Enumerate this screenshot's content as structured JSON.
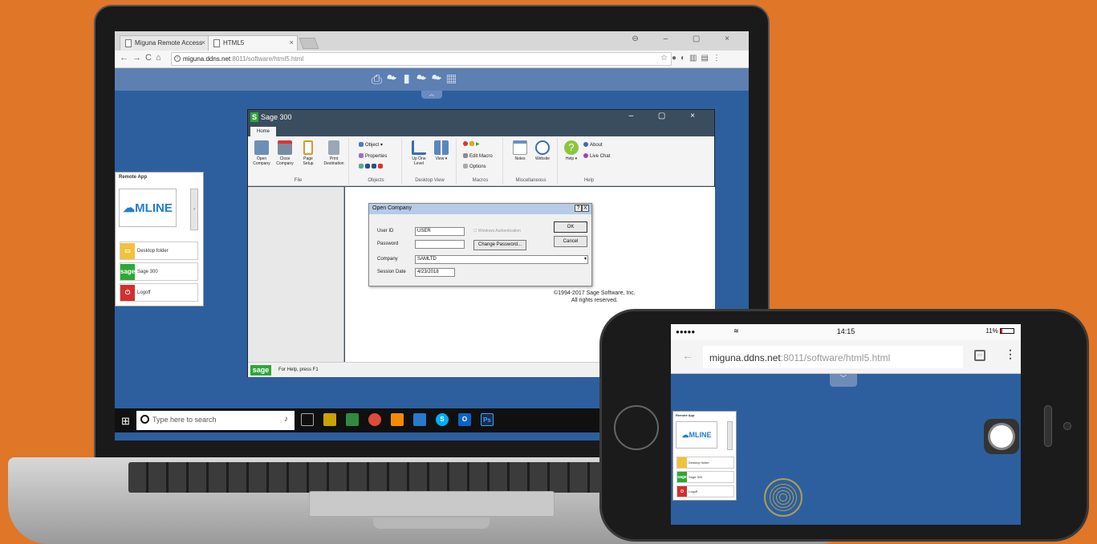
{
  "browser": {
    "tabs": [
      {
        "label": "Miguna Remote Access"
      },
      {
        "label": "HTML5"
      }
    ],
    "url_host": "miguna.ddns.net",
    "url_path": ":8011/software/html5.html"
  },
  "remote_app_panel": {
    "title": "Remote App",
    "logo_text": "MLINE",
    "items": [
      {
        "label": "Desktop folder",
        "icon": "folder-icon",
        "color": "#f3c13a"
      },
      {
        "label": "Sage 300",
        "icon": "sage-icon",
        "color": "#2da836",
        "icon_text": "sage"
      },
      {
        "label": "Logoff",
        "icon": "power-icon",
        "color": "#d0302f"
      }
    ]
  },
  "sage": {
    "title": "Sage 300",
    "ribbon_tab": "Home",
    "file_group": {
      "label": "File",
      "buttons": [
        "Open Company",
        "Close Company",
        "Page Setup",
        "Print Destination"
      ]
    },
    "objects_group": {
      "label": "Objects",
      "object": "Object",
      "properties": "Properties"
    },
    "desktop_view_group": {
      "label": "Desktop View",
      "up_one_level": "Up One Level",
      "view": "View"
    },
    "macros_group": {
      "label": "Macros",
      "edit_macro": "Edit Macro",
      "options": "Options"
    },
    "misc_group": {
      "label": "Miscellaneous",
      "notes": "Notes",
      "website": "Website"
    },
    "help_group": {
      "label": "Help",
      "help": "Help",
      "about": "About",
      "live_chat": "Live Chat"
    },
    "copyright_line1": "©1994-2017 Sage Software, Inc.",
    "copyright_line2": "All rights reserved.",
    "status_text": "For Help, press F1",
    "status_logo": "sage"
  },
  "dialog": {
    "title": "Open Company",
    "help_btn": "?",
    "close_btn": "X",
    "user_id_label": "User ID",
    "user_id_value": "USER",
    "password_label": "Password",
    "password_value": "",
    "windows_auth_label": "Windows Authentication",
    "change_password": "Change Password...",
    "company_label": "Company",
    "company_value": "SAMLTD",
    "session_date_label": "Session Date",
    "session_date_value": "4/23/2018",
    "ok": "OK",
    "cancel": "Cancel"
  },
  "taskbar": {
    "search_placeholder": "Type here to search",
    "apps": [
      {
        "icon": "task-view-icon",
        "color": "#333333",
        "text": ""
      },
      {
        "icon": "winamp-icon",
        "color": "#c9a400",
        "text": ""
      },
      {
        "icon": "photos-icon",
        "color": "#2f8a3f",
        "text": ""
      },
      {
        "icon": "chrome-icon",
        "color": "#dd4b39",
        "text": ""
      },
      {
        "icon": "sublime-icon",
        "color": "#f28b00",
        "text": ""
      },
      {
        "icon": "vscode-icon",
        "color": "#2a7acc",
        "text": ""
      },
      {
        "icon": "skype-icon",
        "color": "#00aff0",
        "text": "S"
      },
      {
        "icon": "outlook-icon",
        "color": "#0a64c6",
        "text": "O"
      },
      {
        "icon": "photoshop-icon",
        "color": "#1b2a4e",
        "text": "Ps"
      }
    ]
  },
  "phone": {
    "time": "14:15",
    "battery": "11%",
    "url_host": "miguna.ddns.net",
    "url_path": ":8011/software/html5.html",
    "panel_title": "Remote App",
    "logo_text": "MLINE",
    "items": [
      {
        "label": "Desktop folder"
      },
      {
        "label": "Sage 300"
      },
      {
        "label": "Logoff"
      }
    ]
  }
}
